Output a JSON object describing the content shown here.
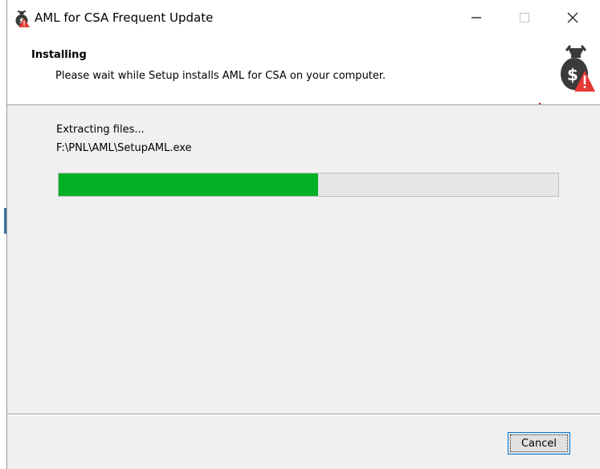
{
  "window": {
    "title": "AML for CSA Frequent Update",
    "app_icon": "money-bag-warning-icon"
  },
  "window_controls": {
    "minimize_icon": "minimize-icon",
    "maximize_icon": "maximize-icon",
    "close_icon": "close-icon"
  },
  "header": {
    "title": "Installing",
    "subtitle": "Please wait while Setup installs AML for CSA on your computer.",
    "icon": "money-bag-warning-icon"
  },
  "status": {
    "text": "Extracting files...",
    "path": "F:\\PNL\\AML\\SetupAML.exe"
  },
  "progress": {
    "percent": 52,
    "color": "#06b025"
  },
  "footer": {
    "cancel_label": "Cancel"
  },
  "colors": {
    "accent": "#0078d7",
    "warning": "#e53935"
  }
}
